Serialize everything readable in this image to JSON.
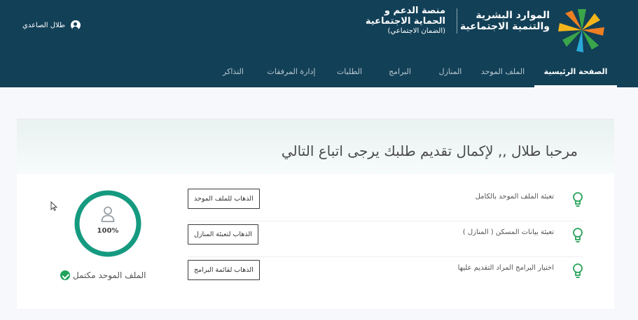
{
  "header": {
    "org_name_line1": "الموارد البشرية",
    "org_name_line2": "والتنمية الاجتماعية",
    "platform_line1": "منصة الدعم و",
    "platform_line2": "الحماية الاجتماعية",
    "platform_line3": "(الضمان الاجتماعي)",
    "user_name": "طلال الصاعدي",
    "user_icon": "user-circle-icon",
    "brand_colors": {
      "header_bg": "#124057",
      "logo_green": "#3aa54a",
      "logo_yellow": "#f4b51b",
      "logo_orange": "#ee7e22",
      "logo_blue": "#2aa7d8"
    }
  },
  "nav": {
    "items": [
      {
        "label": "الصفحة الرئيسية",
        "active": true
      },
      {
        "label": "الملف الموحد",
        "active": false
      },
      {
        "label": "المنازل",
        "active": false
      },
      {
        "label": "البرامج",
        "active": false
      },
      {
        "label": "الطلبات",
        "active": false
      },
      {
        "label": "إدارة المرفقات",
        "active": false
      },
      {
        "label": "التذاكر",
        "active": false
      }
    ]
  },
  "main": {
    "welcome": "مرحبا طلال ,, لإكمال تقديم طلبك يرجى اتباع التالي",
    "steps": [
      {
        "text": "تعبئة الملف الموحد بالكامل",
        "button": "الذهاب للملف الموحد",
        "icon": "lightbulb-icon"
      },
      {
        "text": "تعبئة بيانات المسكن ( المنازل )",
        "button": "الذهاب لتعبئة المنازل",
        "icon": "lightbulb-icon"
      },
      {
        "text": "اختيار البرامج المراد التقديم عليها",
        "button": "الذهاب لقائمة البرامج",
        "icon": "lightbulb-icon"
      }
    ],
    "progress": {
      "value": 100,
      "label": "100%",
      "color": "#159a80"
    },
    "status": {
      "label": "الملف الموحد مكتمل",
      "icon": "check-circle-icon",
      "color": "#22a35b"
    }
  }
}
